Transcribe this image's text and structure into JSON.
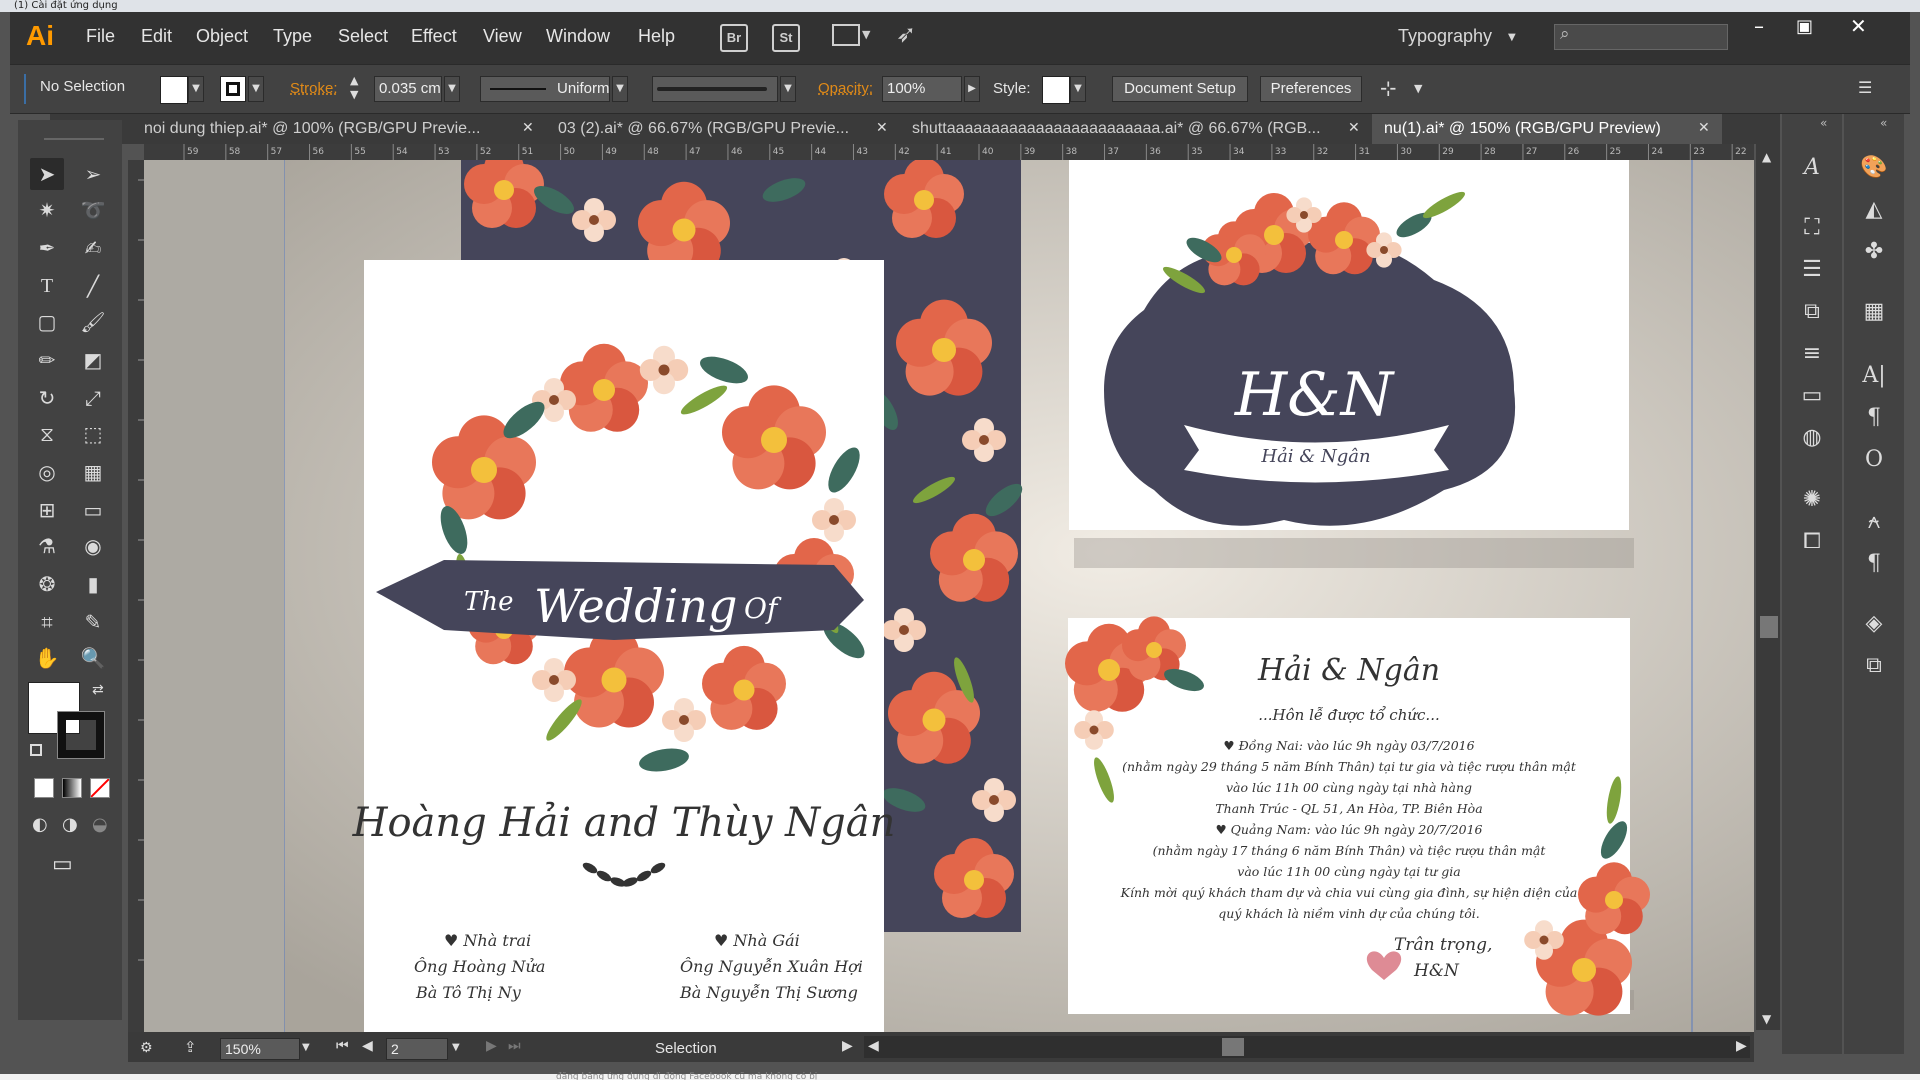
{
  "browser": {
    "tab_title": "(1) Cài đặt ứng dụng"
  },
  "menu": {
    "logo": "Ai",
    "items": [
      "File",
      "Edit",
      "Object",
      "Type",
      "Select",
      "Effect",
      "View",
      "Window",
      "Help"
    ],
    "bridge": "Br",
    "stock": "St",
    "workspace": "Typography"
  },
  "control": {
    "selection": "No Selection",
    "stroke_label": "Stroke:",
    "stroke_value": "0.035 cm",
    "profile": "Uniform",
    "opacity_label": "Opacity:",
    "opacity_value": "100%",
    "style_label": "Style:",
    "document_setup": "Document Setup",
    "preferences": "Preferences"
  },
  "tabs": [
    {
      "label": "noi dung thiep.ai* @ 100% (RGB/GPU Previe...",
      "active": false
    },
    {
      "label": "03 (2).ai* @ 66.67% (RGB/GPU Previe...",
      "active": false
    },
    {
      "label": "shuttaaaaaaaaaaaaaaaaaaaaaaaa.ai* @ 66.67% (RGB...",
      "active": false
    },
    {
      "label": "nu(1).ai* @ 150% (RGB/GPU Preview)",
      "active": true
    }
  ],
  "ruler": {
    "h_ticks": [
      "59",
      "58",
      "57",
      "56",
      "55",
      "54",
      "53",
      "52",
      "51",
      "50",
      "49",
      "48",
      "47",
      "46",
      "45",
      "44",
      "43",
      "42",
      "41",
      "40",
      "39",
      "38",
      "37",
      "36",
      "35",
      "34",
      "33",
      "32",
      "31",
      "30",
      "29",
      "28",
      "27",
      "26",
      "25",
      "24",
      "23",
      "22"
    ]
  },
  "status": {
    "zoom": "150%",
    "artboard": "2",
    "tool": "Selection"
  },
  "card_front": {
    "banner_the": "The",
    "banner_wedding": "Wedding",
    "banner_of": "Of",
    "names": "Hoàng Hải and Thùy Ngân",
    "groom_title": "♥ Nhà trai",
    "groom_father": "Ông   Hoàng Nửa",
    "groom_mother": "Bà    Tô Thị Ny",
    "bride_title": "♥ Nhà Gái",
    "bride_father": "Ông  Nguyễn Xuân Hợi",
    "bride_mother": "Bà  Nguyễn Thị Sương"
  },
  "badge": {
    "monogram": "H&N",
    "ribbon": "Hải & Ngân"
  },
  "card_back": {
    "title": "Hải & Ngân",
    "subtitle": "...Hôn lễ được tổ chức...",
    "lines": [
      "♥ Đồng Nai: vào lúc 9h ngày 03/7/2016",
      "(nhằm ngày 29 tháng 5 năm Bính Thân) tại tư gia và tiệc rượu thân mật",
      "vào lúc 11h 00 cùng ngày tại nhà hàng",
      "Thanh Trúc - QL 51, An Hòa, TP. Biên Hòa",
      "♥ Quảng Nam: vào lúc 9h ngày 20/7/2016",
      "(nhằm ngày 17 tháng 6 năm Bính Thân) và tiệc rượu thân mật",
      "vào lúc 11h 00 cùng ngày tại tư gia",
      "Kính mời quý khách tham dự và chia vui cùng gia đình, sự hiện diện của",
      "quý khách là niềm vinh dự của chúng tôi."
    ],
    "sign1": "Trân trọng,",
    "sign2": "H&N"
  },
  "footer_text": "đăng bằng ứng dụng di động Facebook cũ mà không có bị",
  "colors": {
    "accent": "#ff9a00",
    "navy": "#45455a",
    "flower": "#e2664a",
    "leaf": "#3e6b5e"
  }
}
